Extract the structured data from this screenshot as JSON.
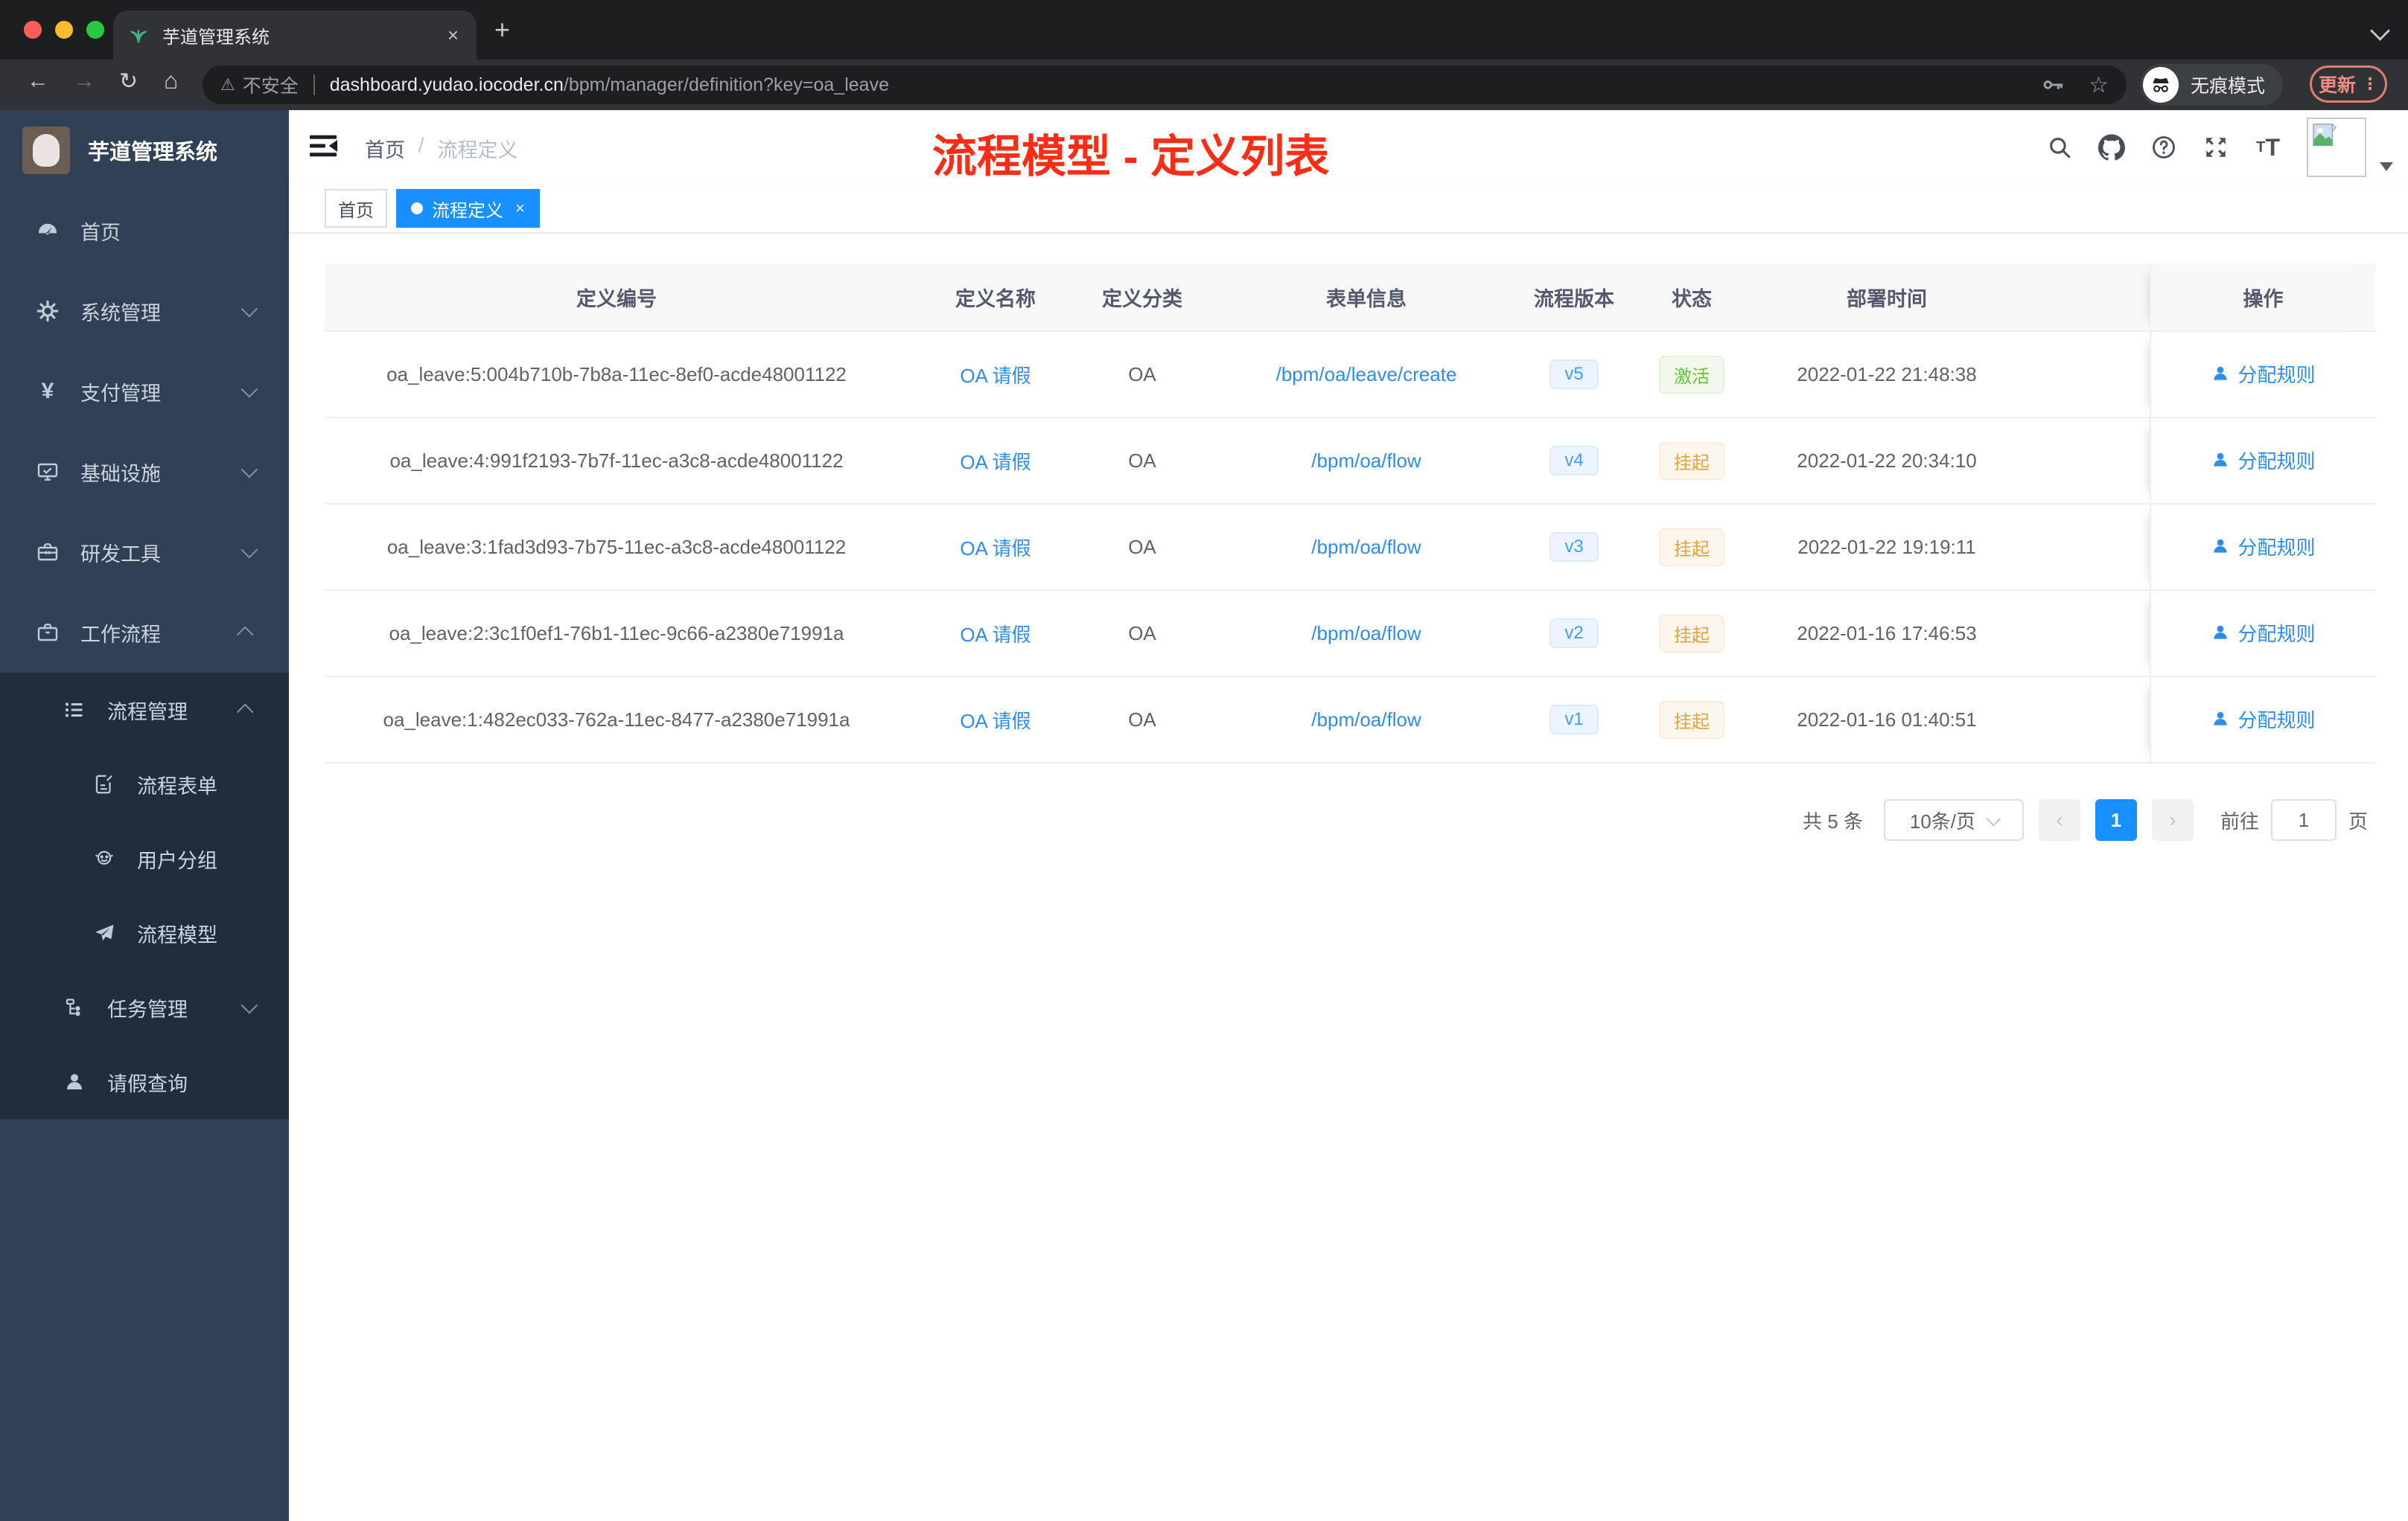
{
  "browser": {
    "tab_title": "芋道管理系统",
    "new_tab": "+",
    "close_tab": "×",
    "security_label": "不安全",
    "url_domain": "dashboard.yudao.iocoder.cn",
    "url_path": "/bpm/manager/definition?key=oa_leave",
    "incognito_label": "无痕模式",
    "update_label": "更新",
    "menu_dots": "⋮"
  },
  "sidebar": {
    "logo_title": "芋道管理系统",
    "menu": [
      {
        "label": "首页",
        "icon": "dashboard-icon"
      },
      {
        "label": "系统管理",
        "icon": "gear-icon"
      },
      {
        "label": "支付管理",
        "icon": "yen-icon"
      },
      {
        "label": "基础设施",
        "icon": "monitor-icon"
      },
      {
        "label": "研发工具",
        "icon": "toolbox-icon"
      },
      {
        "label": "工作流程",
        "icon": "briefcase-icon"
      },
      {
        "label": "流程管理",
        "icon": "list-icon"
      },
      {
        "label": "流程表单",
        "icon": "form-icon"
      },
      {
        "label": "用户分组",
        "icon": "group-icon"
      },
      {
        "label": "流程模型",
        "icon": "paper-plane-icon"
      },
      {
        "label": "任务管理",
        "icon": "tree-icon"
      },
      {
        "label": "请假查询",
        "icon": "user-icon"
      }
    ]
  },
  "header": {
    "breadcrumb_home": "首页",
    "breadcrumb_sep": "/",
    "breadcrumb_current": "流程定义",
    "annotation": "流程模型 - 定义列表",
    "yen_glyph": "¥"
  },
  "tags": {
    "home": "首页",
    "active": "流程定义",
    "close": "×"
  },
  "table": {
    "columns": {
      "id": "定义编号",
      "name": "定义名称",
      "category": "定义分类",
      "form": "表单信息",
      "version": "流程版本",
      "status": "状态",
      "deploy_time": "部署时间",
      "action": "操作"
    },
    "rows": [
      {
        "id": "oa_leave:5:004b710b-7b8a-11ec-8ef0-acde48001122",
        "name": "OA 请假",
        "category": "OA",
        "form": "/bpm/oa/leave/create",
        "version": "v5",
        "status": "激活",
        "status_type": "success",
        "deploy_time": "2022-01-22 21:48:38",
        "action": "分配规则"
      },
      {
        "id": "oa_leave:4:991f2193-7b7f-11ec-a3c8-acde48001122",
        "name": "OA 请假",
        "category": "OA",
        "form": "/bpm/oa/flow",
        "version": "v4",
        "status": "挂起",
        "status_type": "warning",
        "deploy_time": "2022-01-22 20:34:10",
        "action": "分配规则"
      },
      {
        "id": "oa_leave:3:1fad3d93-7b75-11ec-a3c8-acde48001122",
        "name": "OA 请假",
        "category": "OA",
        "form": "/bpm/oa/flow",
        "version": "v3",
        "status": "挂起",
        "status_type": "warning",
        "deploy_time": "2022-01-22 19:19:11",
        "action": "分配规则"
      },
      {
        "id": "oa_leave:2:3c1f0ef1-76b1-11ec-9c66-a2380e71991a",
        "name": "OA 请假",
        "category": "OA",
        "form": "/bpm/oa/flow",
        "version": "v2",
        "status": "挂起",
        "status_type": "warning",
        "deploy_time": "2022-01-16 17:46:53",
        "action": "分配规则"
      },
      {
        "id": "oa_leave:1:482ec033-762a-11ec-8477-a2380e71991a",
        "name": "OA 请假",
        "category": "OA",
        "form": "/bpm/oa/flow",
        "version": "v1",
        "status": "挂起",
        "status_type": "warning",
        "deploy_time": "2022-01-16 01:40:51",
        "action": "分配规则"
      }
    ]
  },
  "pagination": {
    "total_text": "共 5 条",
    "page_size": "10条/页",
    "prev": "‹",
    "current_page": "1",
    "next": "›",
    "goto_label": "前往",
    "goto_value": "1",
    "page_label": "页"
  },
  "colors": {
    "accent_blue": "#1890ff",
    "link_blue": "#2d8cf0",
    "success_green": "#67c23a",
    "warning_orange": "#e6a23c",
    "sidebar_bg": "#304156",
    "submenu_bg": "#1f2d3d",
    "annotation_red": "#fb2d17"
  }
}
